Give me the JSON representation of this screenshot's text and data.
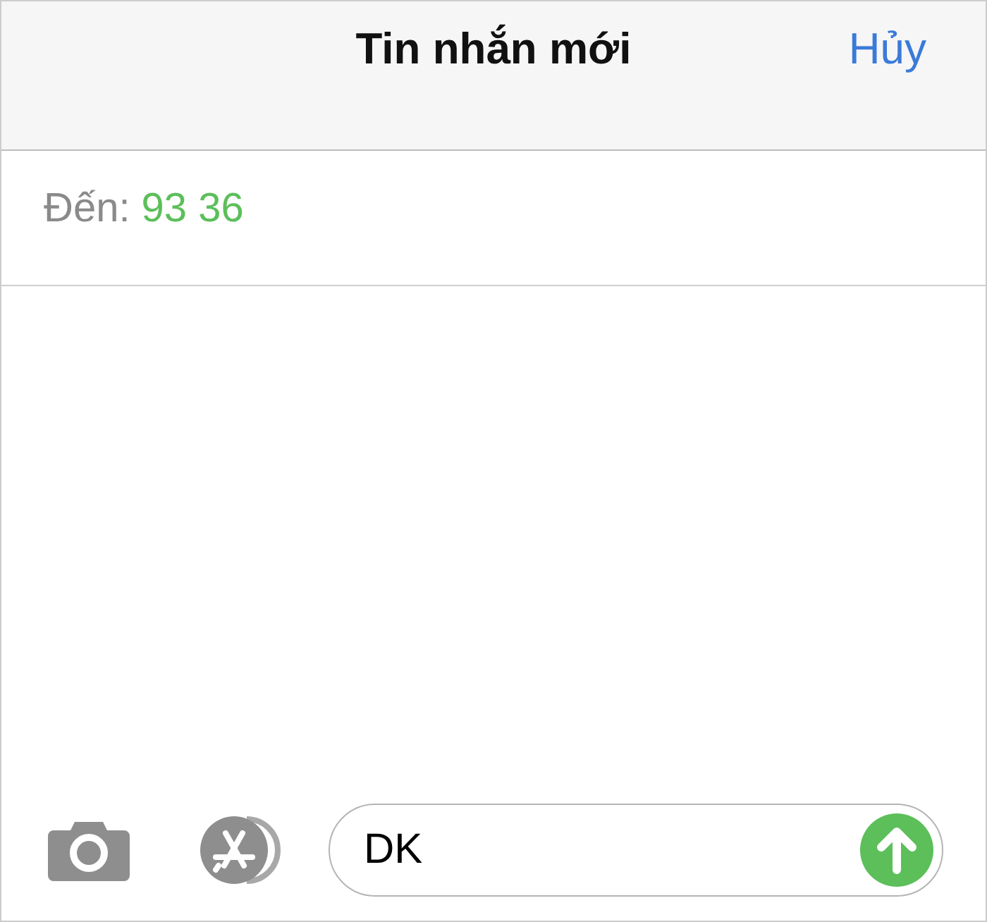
{
  "header": {
    "title": "Tin nhắn mới",
    "cancel": "Hủy"
  },
  "recipient": {
    "label": "Đến:",
    "value": "93 36"
  },
  "composer": {
    "value": "DK"
  }
}
